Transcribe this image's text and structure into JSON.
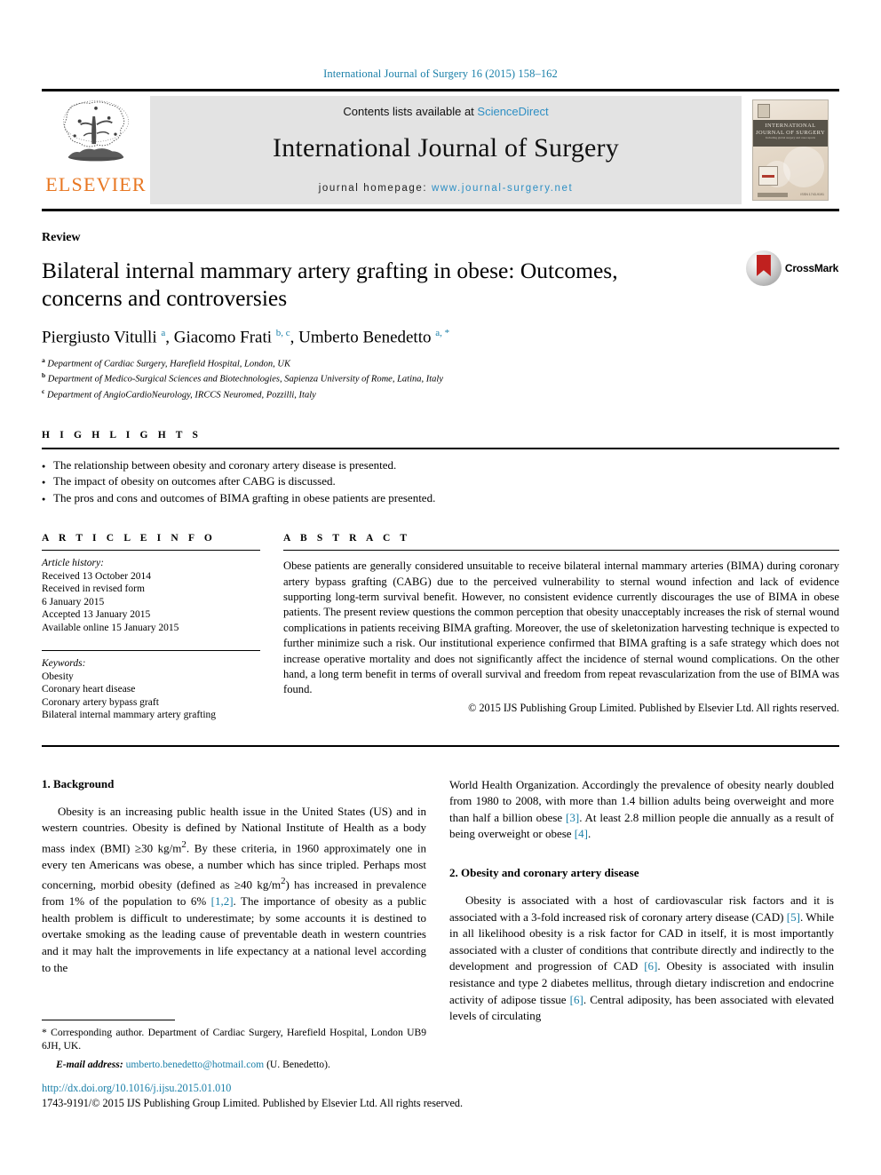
{
  "running_head": "International Journal of Surgery 16 (2015) 158–162",
  "masthead": {
    "publisher_name": "ELSEVIER",
    "publisher_logo_icon": "elsevier-tree-icon",
    "contents_prefix": "Contents lists available at ",
    "contents_link": "ScienceDirect",
    "journal_name": "International Journal of Surgery",
    "homepage_prefix": "journal homepage: ",
    "homepage_url": "www.journal-surgery.net",
    "cover": {
      "title_line1": "INTERNATIONAL",
      "title_line2": "JOURNAL OF SURGERY",
      "subtitle": "Including global surgery and case reports",
      "issn": "ISSN 1743-9191"
    }
  },
  "article": {
    "doctype": "Review",
    "title": "Bilateral internal mammary artery grafting in obese: Outcomes, concerns and controversies",
    "authors_html": "Piergiusto Vitulli <sup>a</sup>, Giacomo Frati <sup>b, c</sup>, Umberto Benedetto <sup>a, *</sup>",
    "affiliations": [
      {
        "marker": "a",
        "text": "Department of Cardiac Surgery, Harefield Hospital, London, UK"
      },
      {
        "marker": "b",
        "text": "Department of Medico-Surgical Sciences and Biotechnologies, Sapienza University of Rome, Latina, Italy"
      },
      {
        "marker": "c",
        "text": "Department of AngioCardioNeurology, IRCCS Neuromed, Pozzilli, Italy"
      }
    ],
    "crossmark_label": "CrossMark"
  },
  "highlights": {
    "heading": "H I G H L I G H T S",
    "items": [
      "The relationship between obesity and coronary artery disease is presented.",
      "The impact of obesity on outcomes after CABG is discussed.",
      "The pros and cons and outcomes of BIMA grafting in obese patients are presented."
    ]
  },
  "article_info": {
    "heading": "A R T I C L E   I N F O",
    "history_label": "Article history:",
    "history": [
      "Received 13 October 2014",
      "Received in revised form",
      "6 January 2015",
      "Accepted 13 January 2015",
      "Available online 15 January 2015"
    ],
    "keywords_label": "Keywords:",
    "keywords": [
      "Obesity",
      "Coronary heart disease",
      "Coronary artery bypass graft",
      "Bilateral internal mammary artery grafting"
    ]
  },
  "abstract": {
    "heading": "A B S T R A C T",
    "text": "Obese patients are generally considered unsuitable to receive bilateral internal mammary arteries (BIMA) during coronary artery bypass grafting (CABG) due to the perceived vulnerability to sternal wound infection and lack of evidence supporting long-term survival benefit. However, no consistent evidence currently discourages the use of BIMA in obese patients. The present review questions the common perception that obesity unacceptably increases the risk of sternal wound complications in patients receiving BIMA grafting. Moreover, the use of skeletonization harvesting technique is expected to further minimize such a risk. Our institutional experience confirmed that BIMA grafting is a safe strategy which does not increase operative mortality and does not significantly affect the incidence of sternal wound complications. On the other hand, a long term benefit in terms of overall survival and freedom from repeat revascularization from the use of BIMA was found.",
    "copyright": "© 2015 IJS Publishing Group Limited. Published by Elsevier Ltd. All rights reserved."
  },
  "body": {
    "left": {
      "section1_heading": "1. Background",
      "section1_para1_a": "Obesity is an increasing public health issue in the United States (US) and in western countries. Obesity is defined by National Institute of Health as a body mass index (BMI) ≥30 kg/m",
      "section1_para1_sup1": "2",
      "section1_para1_b": ". By these criteria, in 1960 approximately one in every ten Americans was obese, a number which has since tripled. Perhaps most concerning, morbid obesity (defined as ≥40 kg/m",
      "section1_para1_sup2": "2",
      "section1_para1_c": ") has increased in prevalence from 1% of the population to 6% ",
      "section1_para1_ref": "[1,2]",
      "section1_para1_d": ". The importance of obesity as a public health problem is difficult to underestimate; by some accounts it is destined to overtake smoking as the leading cause of preventable death in western countries and it may halt the improvements in life expectancy at a national level according to the"
    },
    "right": {
      "cont_a": "World Health Organization. Accordingly the prevalence of obesity nearly doubled from 1980 to 2008, with more than 1.4 billion adults being overweight and more than half a billion obese ",
      "cont_ref3": "[3]",
      "cont_b": ". At least 2.8 million people die annually as a result of being overweight or obese ",
      "cont_ref4": "[4]",
      "cont_c": ".",
      "section2_heading": "2. Obesity and coronary artery disease",
      "section2_para_a": "Obesity is associated with a host of cardiovascular risk factors and it is associated with a 3-fold increased risk of coronary artery disease (CAD) ",
      "section2_ref5": "[5]",
      "section2_para_b": ". While in all likelihood obesity is a risk factor for CAD in itself, it is most importantly associated with a cluster of conditions that contribute directly and indirectly to the development and progression of CAD ",
      "section2_ref6a": "[6]",
      "section2_para_c": ". Obesity is associated with insulin resistance and type 2 diabetes mellitus, through dietary indiscretion and endocrine activity of adipose tissue ",
      "section2_ref6b": "[6]",
      "section2_para_d": ". Central adiposity, has been associated with elevated levels of circulating"
    }
  },
  "footnote": {
    "corresponding": "* Corresponding author. Department of Cardiac Surgery, Harefield Hospital, London UB9 6JH, UK.",
    "email_label": "E-mail address:",
    "email": "umberto.benedetto@hotmail.com",
    "email_owner": "(U. Benedetto)."
  },
  "footer": {
    "doi": "http://dx.doi.org/10.1016/j.ijsu.2015.01.010",
    "issn_line": "1743-9191/© 2015 IJS Publishing Group Limited. Published by Elsevier Ltd. All rights reserved."
  },
  "colors": {
    "link_blue": "#1a7fa8",
    "sciencedirect_blue": "#2e8fc4",
    "elsevier_orange": "#E87722",
    "band_gray": "#e3e3e3"
  }
}
